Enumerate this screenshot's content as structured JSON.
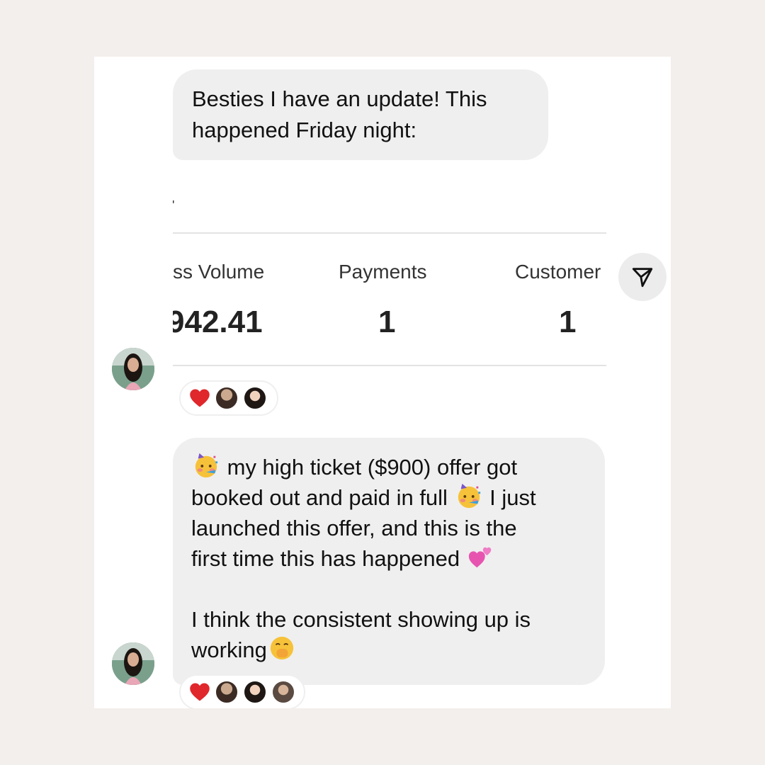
{
  "messages": [
    {
      "lines": [
        "Besties I have an update!  This",
        "happened Friday night:"
      ]
    },
    {
      "lines": [
        [
          "",
          "my high ticket ($900) offer got"
        ],
        [
          "booked out and paid in full ",
          " I just"
        ],
        [
          "launched this offer, and this is the"
        ],
        [
          "first time this has happened ",
          ""
        ],
        [
          "I think the consistent showing up is"
        ],
        [
          "working",
          ""
        ]
      ]
    }
  ],
  "screenshot": {
    "mark": "'",
    "columns": [
      {
        "header": "ss Volume",
        "value": "942.41"
      },
      {
        "header": "Payments",
        "value": "1"
      },
      {
        "header": "Customer",
        "value": "1"
      }
    ]
  },
  "reactions": {
    "first": {
      "emoji": "heart",
      "people": 2
    },
    "second": {
      "emoji": "heart",
      "people": 3
    }
  },
  "icons": {
    "share": "paper-plane-icon",
    "emoji_party": "partying-face-icon",
    "emoji_hearts": "two-hearts-icon",
    "emoji_shush": "face-with-hand-over-mouth-icon"
  },
  "colors": {
    "background": "#f3efec",
    "bubble": "#efefef",
    "heart": "#e0272b"
  }
}
